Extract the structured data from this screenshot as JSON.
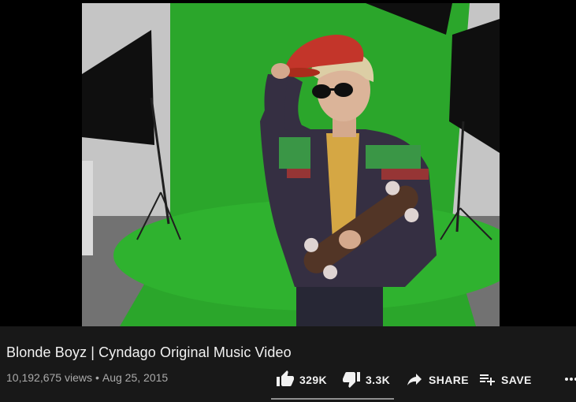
{
  "video": {
    "title": "Blonde Boyz | Cyndago Original Music Video",
    "views": "10,192,675 views",
    "date": "Aug 25, 2015",
    "separator": "•"
  },
  "actions": {
    "like_count": "329K",
    "dislike_count": "3.3K",
    "share_label": "SHARE",
    "save_label": "SAVE",
    "icons": {
      "like": "thumb-up-icon",
      "dislike": "thumb-down-icon",
      "share": "share-arrow-icon",
      "save": "playlist-add-icon",
      "more": "more-horizontal-icon"
    }
  },
  "colors": {
    "background": "#181818",
    "text_primary": "#f1f1f1",
    "text_secondary": "#aaaaaa",
    "greenscreen": "#2fb52f"
  }
}
